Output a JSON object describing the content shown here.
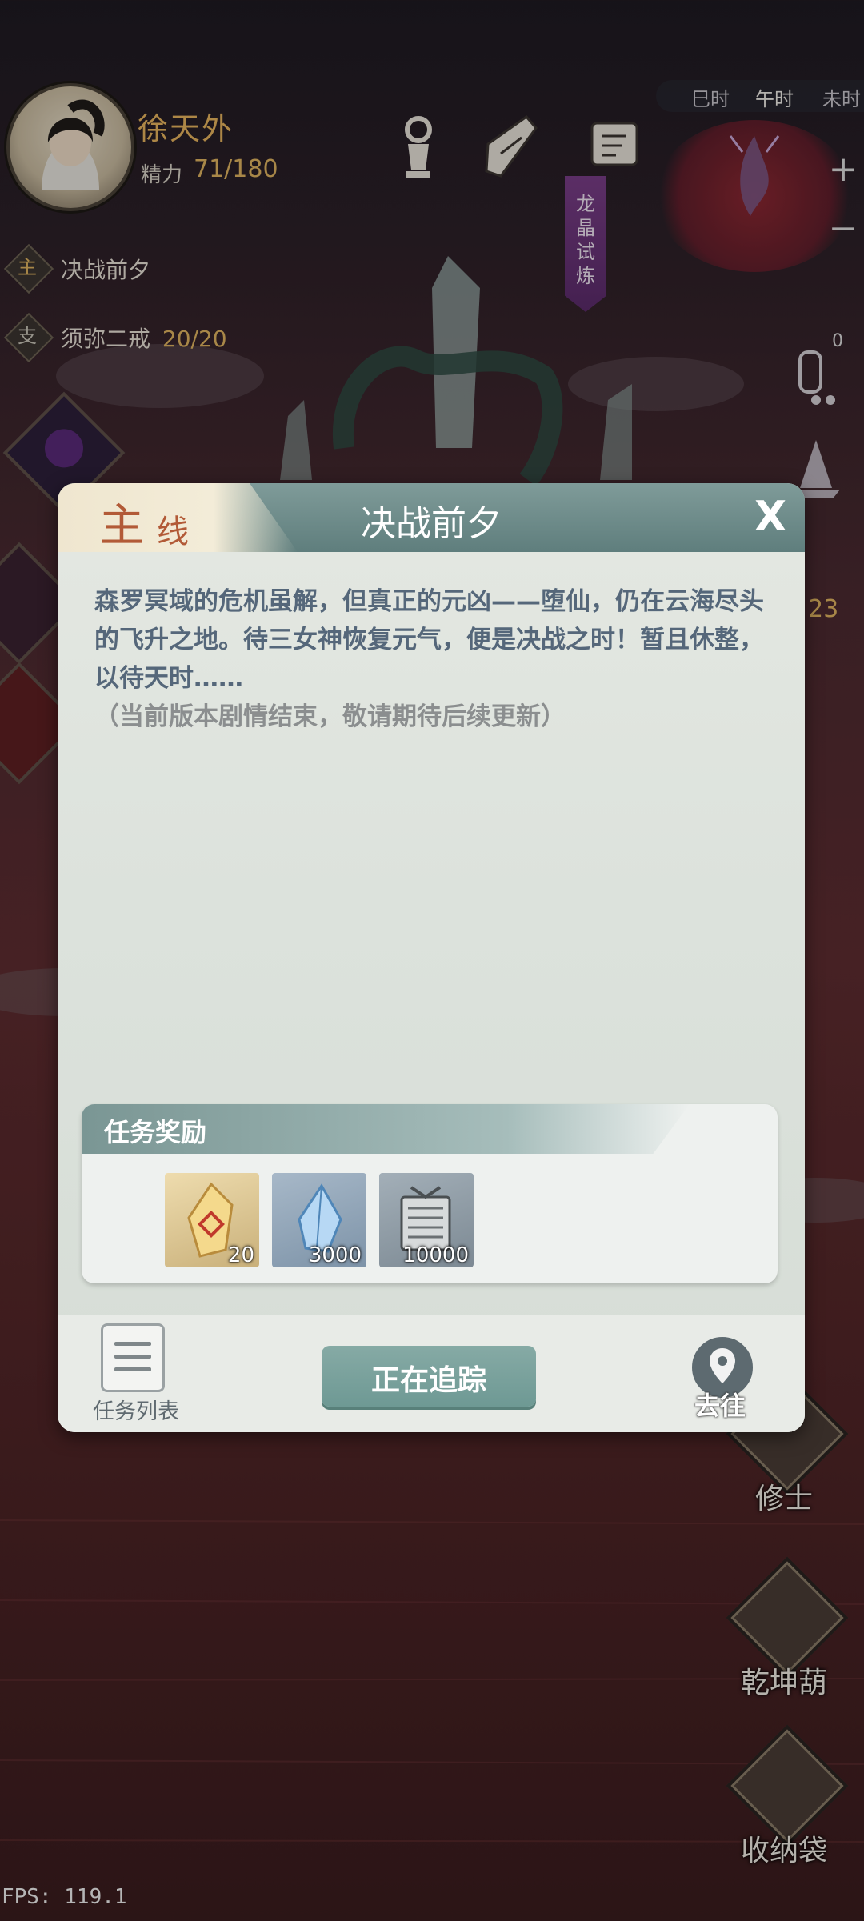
{
  "player": {
    "name": "徐天外",
    "energy_label": "精力",
    "energy_value": "71/180"
  },
  "quests": [
    {
      "badge": "主",
      "text": "决战前夕",
      "progress": ""
    },
    {
      "badge": "支",
      "text": "须弥二戒",
      "progress": "20/20"
    }
  ],
  "top_icons": [
    "tower-icon",
    "scroll-icon",
    "map-icon"
  ],
  "dragon_trial": {
    "label": "龙晶试炼"
  },
  "time_bar": {
    "items": [
      "巳时",
      "午时",
      "未时"
    ]
  },
  "zoom": {
    "plus": "+",
    "minus": "−"
  },
  "side_counter": "0",
  "left_partial_number": "23",
  "right_buttons": [
    {
      "label": "修士",
      "icon": "cultivator-icon"
    },
    {
      "label": "乾坤葫",
      "icon": "gourd-icon"
    },
    {
      "label": "收纳袋",
      "icon": "storage-bag-icon"
    }
  ],
  "fps": "FPS: 119.1",
  "dialog": {
    "tag_main": "主",
    "tag_sub": "线",
    "title": "决战前夕",
    "close": "X",
    "description": "森罗冥域的危机虽解，但真正的元凶——堕仙，仍在云海尽头的飞升之地。待三女神恢复元气，便是决战之时！暂且休整，以待天时……",
    "note": "（当前版本剧情结束，敬请期待后续更新）",
    "reward_title": "任务奖励",
    "rewards": [
      {
        "icon": "golden-crystal-icon",
        "count": "20",
        "bg": "#d9c79a"
      },
      {
        "icon": "blue-crystal-icon",
        "count": "3000",
        "bg": "#93a6b7"
      },
      {
        "icon": "scroll-bundle-icon",
        "count": "10000",
        "bg": "#8e9aa3"
      }
    ],
    "task_list_label": "任务列表",
    "tracking_label": "正在追踪",
    "goto_label": "去往"
  },
  "colors": {
    "accent": "#6e9994",
    "gold": "#e0b560",
    "tag_red": "#b25a37"
  }
}
